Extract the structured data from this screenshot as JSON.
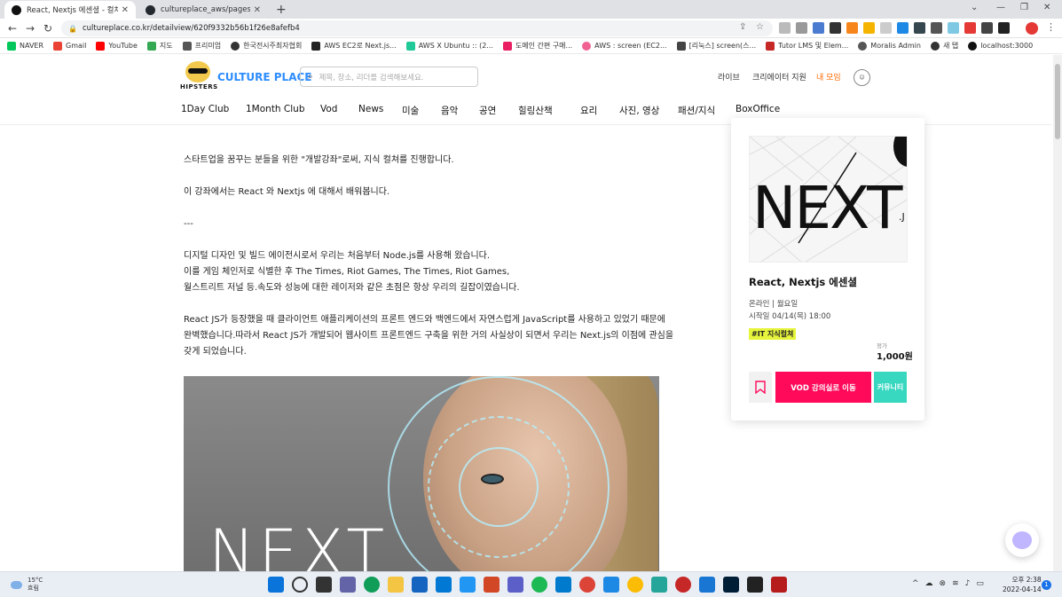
{
  "browser": {
    "tabs": [
      {
        "title": "React, Nextjs 에센셜 - 컬쳐플리"
      },
      {
        "title": "cultureplace_aws/pages/payme"
      }
    ],
    "url": "cultureplace.co.kr/detailview/620f9332b56b1f26e8afefb4",
    "bookmarks": [
      "NAVER",
      "Gmail",
      "YouTube",
      "지도",
      "프리미엄",
      "한국전시주최자협회",
      "AWS EC2로 Next.js...",
      "AWS X Ubuntu :: (2...",
      "도메인 간편 구매...",
      "AWS : screen (EC2...",
      "[리눅스] screen(스...",
      "Tutor LMS 및 Elem...",
      "Moralis Admin",
      "새 탭",
      "localhost:3000"
    ]
  },
  "site": {
    "brand": "CULTURE PLACE",
    "logo_text": "HIPSTERS",
    "search_placeholder": "제목, 장소, 리더를 검색해보세요.",
    "util_links": [
      "라이브",
      "크리에이터 지원",
      "내 모임"
    ],
    "categories": [
      "1Day Club",
      "1Month Club",
      "Vod",
      "News",
      "미술",
      "음악",
      "공연",
      "힐링산책",
      "요리",
      "사진, 영상",
      "패션/지식",
      "BoxOffice"
    ]
  },
  "content": {
    "lines": [
      "스타트업을 꿈꾸는 분들을 위한 \"개발강좌\"로써, 지식 컬쳐를 진행합니다.",
      "이 강좌에서는 React 와 Nextjs 에 대해서 배워봅니다.",
      "---",
      "디지털 디자인 및 빌드 에이전시로서 우리는 처음부터 Node.js를 사용해 왔습니다.",
      "이를 게임 체인저로 식별한 후 The Times, Riot Games, The Times, Riot Games,",
      "월스트리트 저널 등.속도와 성능에 대한 레이저와 같은 초점은 항상 우리의 길잡이였습니다.",
      "React JS가 등장했을 때 클라이언트 애플리케이션의 프론트 엔드와 백엔드에서 자연스럽게 JavaScript를 사용하고 있었기 때문에",
      "완벽했습니다.따라서 React JS가 개발되어 웹사이트 프론트엔드 구축을 위한 거의 사실상이 되면서 우리는 Next.js의 이점에 관심을",
      "갖게 되었습니다."
    ],
    "hero_text": "NEXT"
  },
  "card": {
    "thumb_text": "NEXT",
    "thumb_suffix": ".J",
    "title": "React, Nextjs 에센셜",
    "meta_schedule": "온라인 | 월요일",
    "meta_start": "시작일 04/14(목) 18:00",
    "tag": "#IT 지식컬쳐",
    "price_label": "정가",
    "price": "1,000원",
    "vod_button": "VOD 강의실로 이동",
    "community_button": "커뮤니티"
  },
  "taskbar": {
    "temperature": "15°C",
    "weather": "흐림",
    "time": "오후 2:38",
    "date": "2022-04-14",
    "notification_count": "1"
  },
  "colors": {
    "accent_pink": "#ff0a5a",
    "accent_teal": "#37d7c0",
    "brand_blue": "#2d8cff",
    "tag_yellow": "#e6f43c",
    "util_orange": "#ff6a00"
  }
}
